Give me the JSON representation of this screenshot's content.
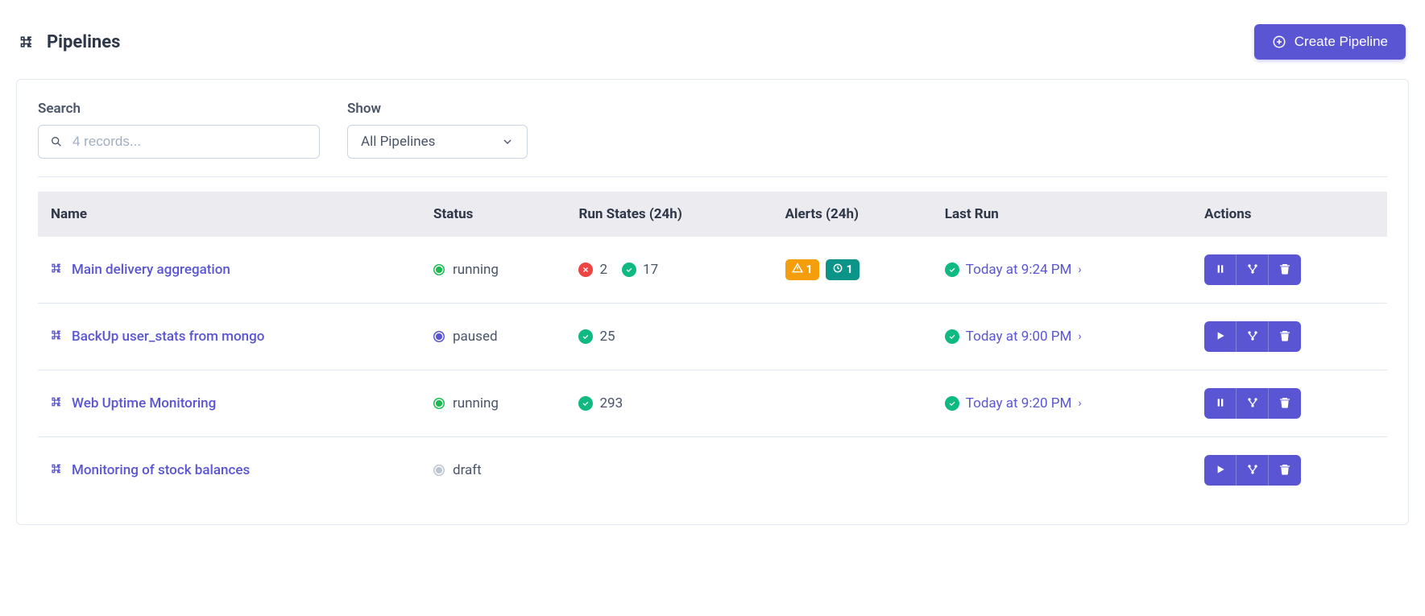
{
  "header": {
    "title": "Pipelines",
    "create_button": "Create Pipeline"
  },
  "filters": {
    "search_label": "Search",
    "search_placeholder": "4 records...",
    "show_label": "Show",
    "show_selected": "All Pipelines"
  },
  "columns": {
    "name": "Name",
    "status": "Status",
    "runstates": "Run States (24h)",
    "alerts": "Alerts (24h)",
    "lastrun": "Last Run",
    "actions": "Actions"
  },
  "rows": [
    {
      "name": "Main delivery aggregation",
      "status": "running",
      "fail_count": "2",
      "success_count": "17",
      "alert_warn": "1",
      "alert_info": "1",
      "last_run": "Today at 9:24 PM",
      "primary_action": "pause"
    },
    {
      "name": "BackUp user_stats from mongo",
      "status": "paused",
      "fail_count": "",
      "success_count": "25",
      "alert_warn": "",
      "alert_info": "",
      "last_run": "Today at 9:00 PM",
      "primary_action": "play"
    },
    {
      "name": "Web Uptime Monitoring",
      "status": "running",
      "fail_count": "",
      "success_count": "293",
      "alert_warn": "",
      "alert_info": "",
      "last_run": "Today at 9:20 PM",
      "primary_action": "pause"
    },
    {
      "name": "Monitoring of stock balances",
      "status": "draft",
      "fail_count": "",
      "success_count": "",
      "alert_warn": "",
      "alert_info": "",
      "last_run": "",
      "primary_action": "play"
    }
  ]
}
